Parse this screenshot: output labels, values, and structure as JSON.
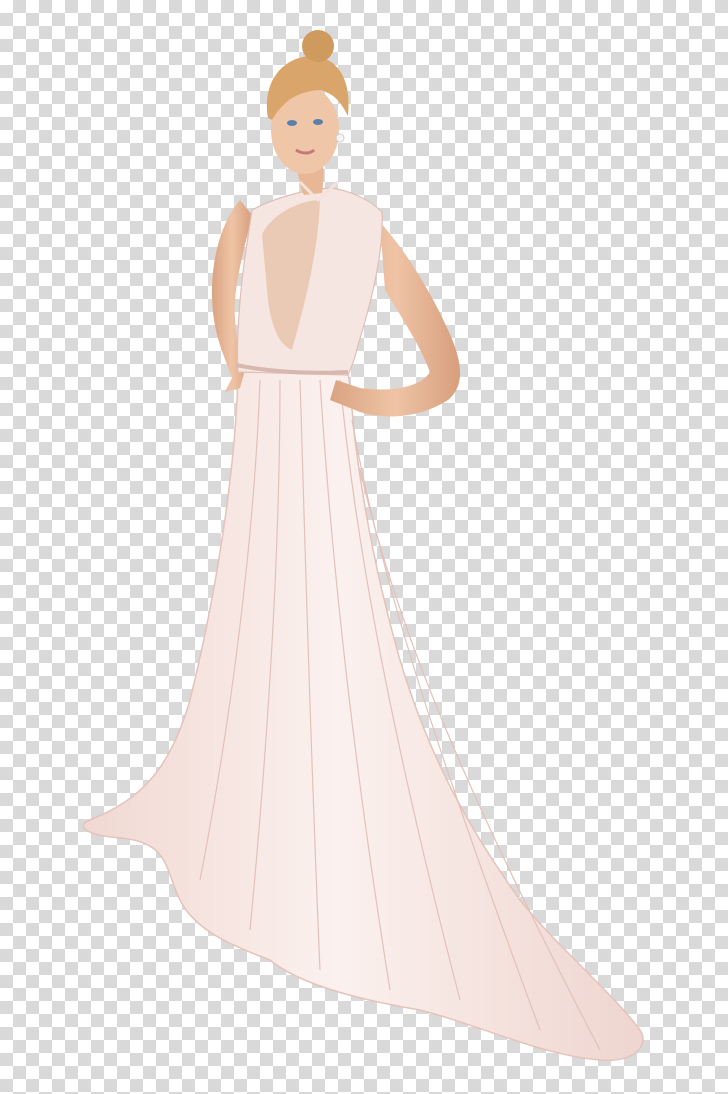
{
  "image": {
    "subject": "woman-in-white-gown",
    "background": "transparency-checkerboard",
    "colors": {
      "checker_light": "#ffffff",
      "checker_dark": "#d9d9d9",
      "skin": "#e8b896",
      "hair": "#d9a56a",
      "gown": "#f7e9e4"
    }
  }
}
